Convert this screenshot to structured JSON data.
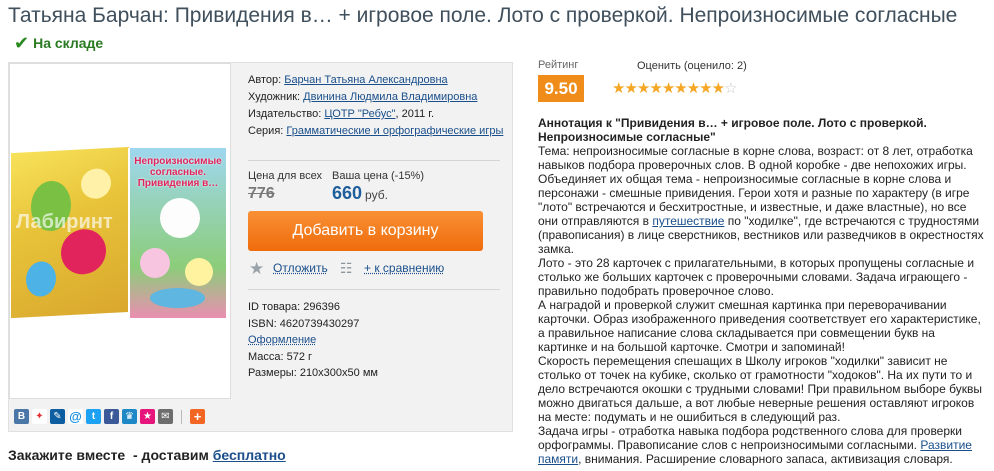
{
  "title": "Татьяна Барчан: Привидения в… + игровое поле. Лото с проверкой. Непроизносимые согласные",
  "stock": {
    "icon": "check-icon",
    "label": "На складе"
  },
  "cover": {
    "box_title": "Непроизносимые согласные. Привидения в…",
    "watermark": "Лабиринт"
  },
  "meta": {
    "author_label": "Автор:",
    "author": "Барчан Татьяна Александровна",
    "artist_label": "Художник:",
    "artist": "Двинина Людмила Владимировна",
    "publisher_label": "Издательство:",
    "publisher": "ЦОТР \"Ребус\"",
    "year": ", 2011 г.",
    "series_label": "Серия:",
    "series": "Грамматические и орфографические игры"
  },
  "price": {
    "all_label": "Цена для всех",
    "old": "776",
    "your_label": "Ваша цена (-15%)",
    "new": "660",
    "currency": "руб."
  },
  "cart_button": "Добавить в корзину",
  "actions": {
    "postpone": "Отложить",
    "compare": "+ к сравнению"
  },
  "specs": {
    "id": "ID товара: 296396",
    "isbn": "ISBN: 4620739430297",
    "design": "Оформление",
    "weight": "Масса: 572 г",
    "size": "Размеры: 210x300x50 мм"
  },
  "share_icons": [
    "vk-icon",
    "person-icon",
    "livejournal-icon",
    "mail-at-icon",
    "twitter-icon",
    "facebook-icon",
    "odnoklassniki-icon",
    "star-bookmark-icon",
    "envelope-icon",
    "plus-icon"
  ],
  "together": {
    "text": "Закажите вместе  - доставим ",
    "link": "бесплатно"
  },
  "rating": {
    "label": "Рейтинг",
    "value": "9.50",
    "rate_label": "Оценить (оценило: 2)",
    "stars_full": 9,
    "stars_total": 10
  },
  "annotation": {
    "heading": "Аннотация к \"Привидения в… + игровое поле. Лото с проверкой. Непроизносимые согласные\"",
    "p1a": "Тема: непроизносимые согласные в корне слова, возраст: от 8 лет, отработка навыков подбора проверочных слов. В одной коробке - две непохожих игры. Объединяет их общая тема - непроизносимые согласные в корне слова и персонажи - смешные привидения. Герои хотя и разные по характеру (в игре \"лото\" встречаются и бесхитростные, и известные, и даже властные), но все они отправляются в ",
    "p1link": "путешествие",
    "p1b": " по \"ходилке\", где встречаются с трудностями (правописания) в лице сверстников, вестников или разведчиков в окрестностях замка.",
    "p2": "Лото - это 28 карточек с прилагательными, в которых пропущены согласные и столько же больших карточек с проверочными словами. Задача играющего - правильно подобрать проверочное слово.",
    "p3": "А наградой и проверкой служит смешная картинка при переворачивании карточки. Образ изображенного приведения соответствует его характеристике, а правильное написание слова складывается при совмещении букв на картинке и на большой карточке. Смотри и запоминай!",
    "p4": "Скорость перемещения спешащих в Школу игроков \"ходилки\" зависит не столько от точек на кубике, сколько от грамотности \"ходоков\". На их пути то и дело встречаются окошки с трудными словами! При правильном выборе буквы можно двигаться дальше, а вот любые неверные решения оставляют игроков на месте: подумать и не ошибиться в следующий раз.",
    "p5a": "Задача игры - отработка навыка подбора родственного слова для проверки орфограммы. Правописание слов с непроизносимыми согласными. ",
    "p5link": "Развитие памяти",
    "p5b": ", внимания. Расширение словарного запаса, активизация словаря."
  }
}
